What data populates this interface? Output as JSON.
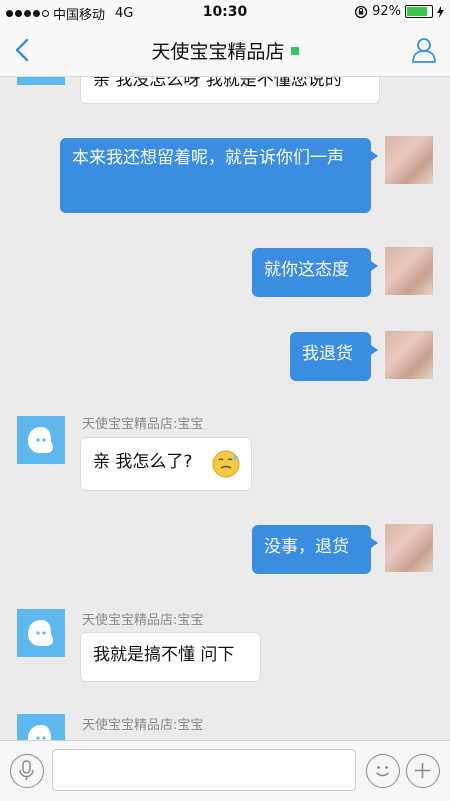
{
  "statusbar": {
    "carrier": "中国移动",
    "network": "4G",
    "time": "10:30",
    "battery_percent": "92%",
    "battery_level": 0.92
  },
  "header": {
    "title": "天使宝宝精品店",
    "online_color": "#34c759"
  },
  "messages": [
    {
      "dir": "in",
      "text": "亲 我没怎么呀 我就是不懂您说的"
    },
    {
      "dir": "out",
      "text": "本来我还想留着呢，就告诉你们一声"
    },
    {
      "dir": "out",
      "text": "就你这态度"
    },
    {
      "dir": "out",
      "text": "我退货"
    },
    {
      "dir": "in",
      "sender": "天使宝宝精品店:宝宝",
      "text": "亲 我怎么了?",
      "emoji": "sweat-smile-emoji"
    },
    {
      "dir": "out",
      "text": "没事，退货"
    },
    {
      "dir": "in",
      "sender": "天使宝宝精品店:宝宝",
      "text": "我就是搞不懂 问下"
    },
    {
      "dir": "in",
      "sender": "天使宝宝精品店:宝宝",
      "text": ""
    }
  ],
  "inputbar": {
    "icons": [
      "microphone-icon",
      "smiley-icon",
      "plus-icon"
    ]
  },
  "colors": {
    "outgoing_bubble": "#3a8de0",
    "accent": "#3a8de0",
    "shop_avatar": "#5eb8ee",
    "background": "#ebebeb"
  }
}
